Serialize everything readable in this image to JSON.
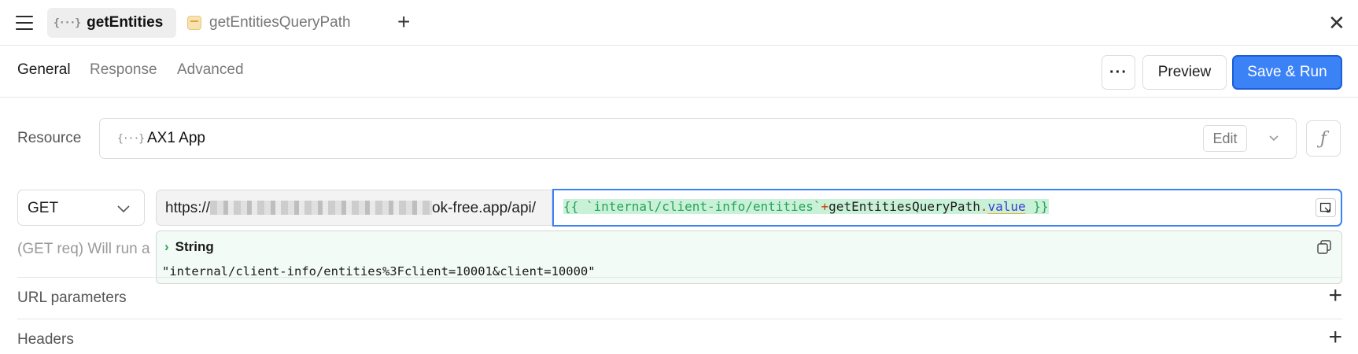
{
  "tabs": [
    {
      "label": "getEntities",
      "icon": "braces-icon",
      "active": true,
      "unsaved": true
    },
    {
      "label": "getEntitiesQueryPath",
      "icon": "variable-icon",
      "active": false
    }
  ],
  "section_tabs": [
    "General",
    "Response",
    "Advanced"
  ],
  "actions": {
    "more": "···",
    "preview": "Preview",
    "save_run": "Save & Run"
  },
  "resource": {
    "label": "Resource",
    "name": "AX1 App",
    "edit": "Edit"
  },
  "request": {
    "method": "GET",
    "url_prefix_start": "https://",
    "url_prefix_end": "ok-free.app/api/",
    "url_template": {
      "open": "{{",
      "string": "`internal/client-info/entities`",
      "plus": "+",
      "ident": "getEntitiesQueryPath",
      "dot": ".",
      "prop": "value",
      "close": "}}"
    }
  },
  "evaluation": {
    "type": "String",
    "value": "\"internal/client-info/entities%3Fclient=10001&client=10000\""
  },
  "hint": "(GET req) Will run a",
  "sections": [
    "URL parameters",
    "Headers"
  ],
  "colors": {
    "accent": "#3b82f6",
    "template_bg": "#c9f1d8",
    "template_green": "#27a35a",
    "eval_bg": "#f2fbf6"
  }
}
